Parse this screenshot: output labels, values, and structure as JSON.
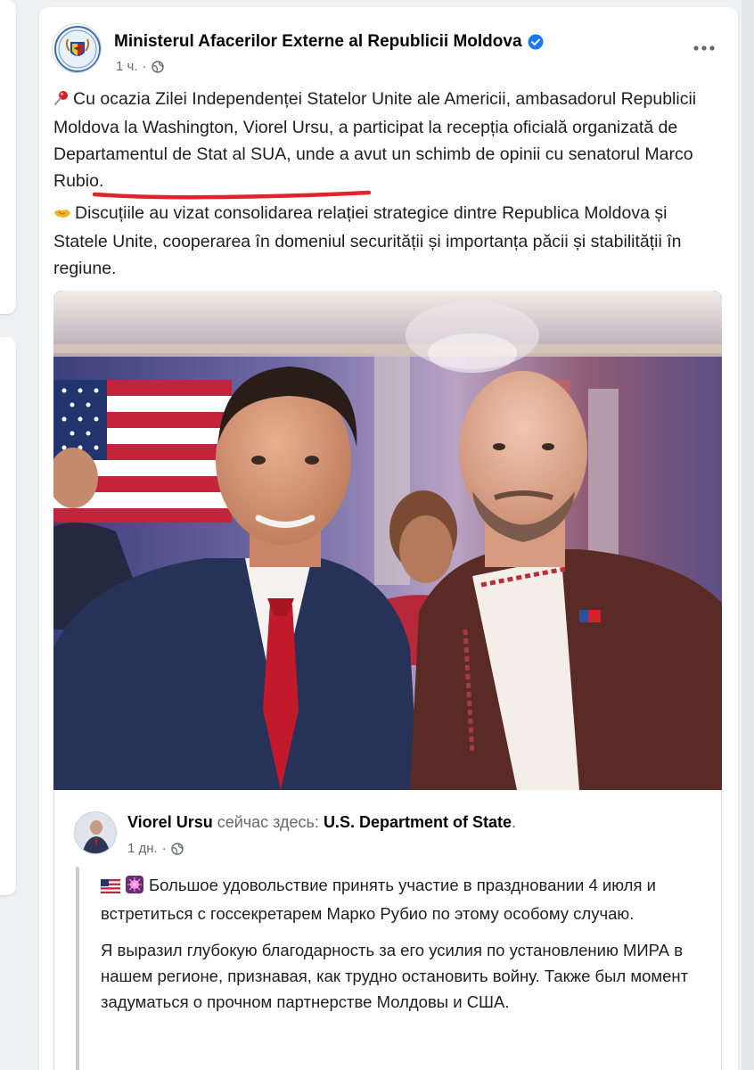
{
  "page": {
    "background": "#eef0f3"
  },
  "post": {
    "author": "Ministerul Afacerilor Externe al Republicii Moldova",
    "verified": true,
    "time": "1 ч.",
    "separator": "·",
    "visibility_icon": "globe-icon",
    "more_icon": "more-options-icon",
    "paragraph1": "Cu ocazia Zilei Independenței Statelor Unite ale Americii, ambasadorul Republicii Moldova la Washington, Viorel Ursu, a participat la recepția oficială organizată de Departamentul de Stat al SUA, unde a avut un schimb de opinii cu senatorul Marco Rubio.",
    "paragraph1_icon": "pushpin-icon",
    "paragraph2": "Discuțiile au vizat consolidarea relației strategice dintre Republica Moldova și Statele Unite, cooperarea în domeniul securității și importanța păcii și stabilității în regiune.",
    "paragraph2_icon": "handshake-icon",
    "highlight_color": "#e0242b",
    "photo_icon": "selfie-photo"
  },
  "shared": {
    "author": "Viorel Ursu",
    "action": " сейчас здесь: ",
    "place": "U.S. Department of State",
    "place_suffix": ".",
    "time": "1 дн.",
    "separator": "·",
    "paragraph1_icons": [
      "us-flag-icon",
      "sparkle-icon"
    ],
    "paragraph1": "Большое удовольствие принять участие в праздновании 4 июля и встретиться с госсекретарем Марко Рубио по этому особому случаю.",
    "paragraph2": "Я выразил глубокую благодарность за его усилия по установлению МИРА в нашем регионе, признавая, как трудно остановить войну. Также был момент задуматься о прочном партнерстве Молдовы и США."
  },
  "colors": {
    "verified": "#1877f2",
    "meta_text": "#65676b",
    "body_text": "#1c1e21"
  }
}
